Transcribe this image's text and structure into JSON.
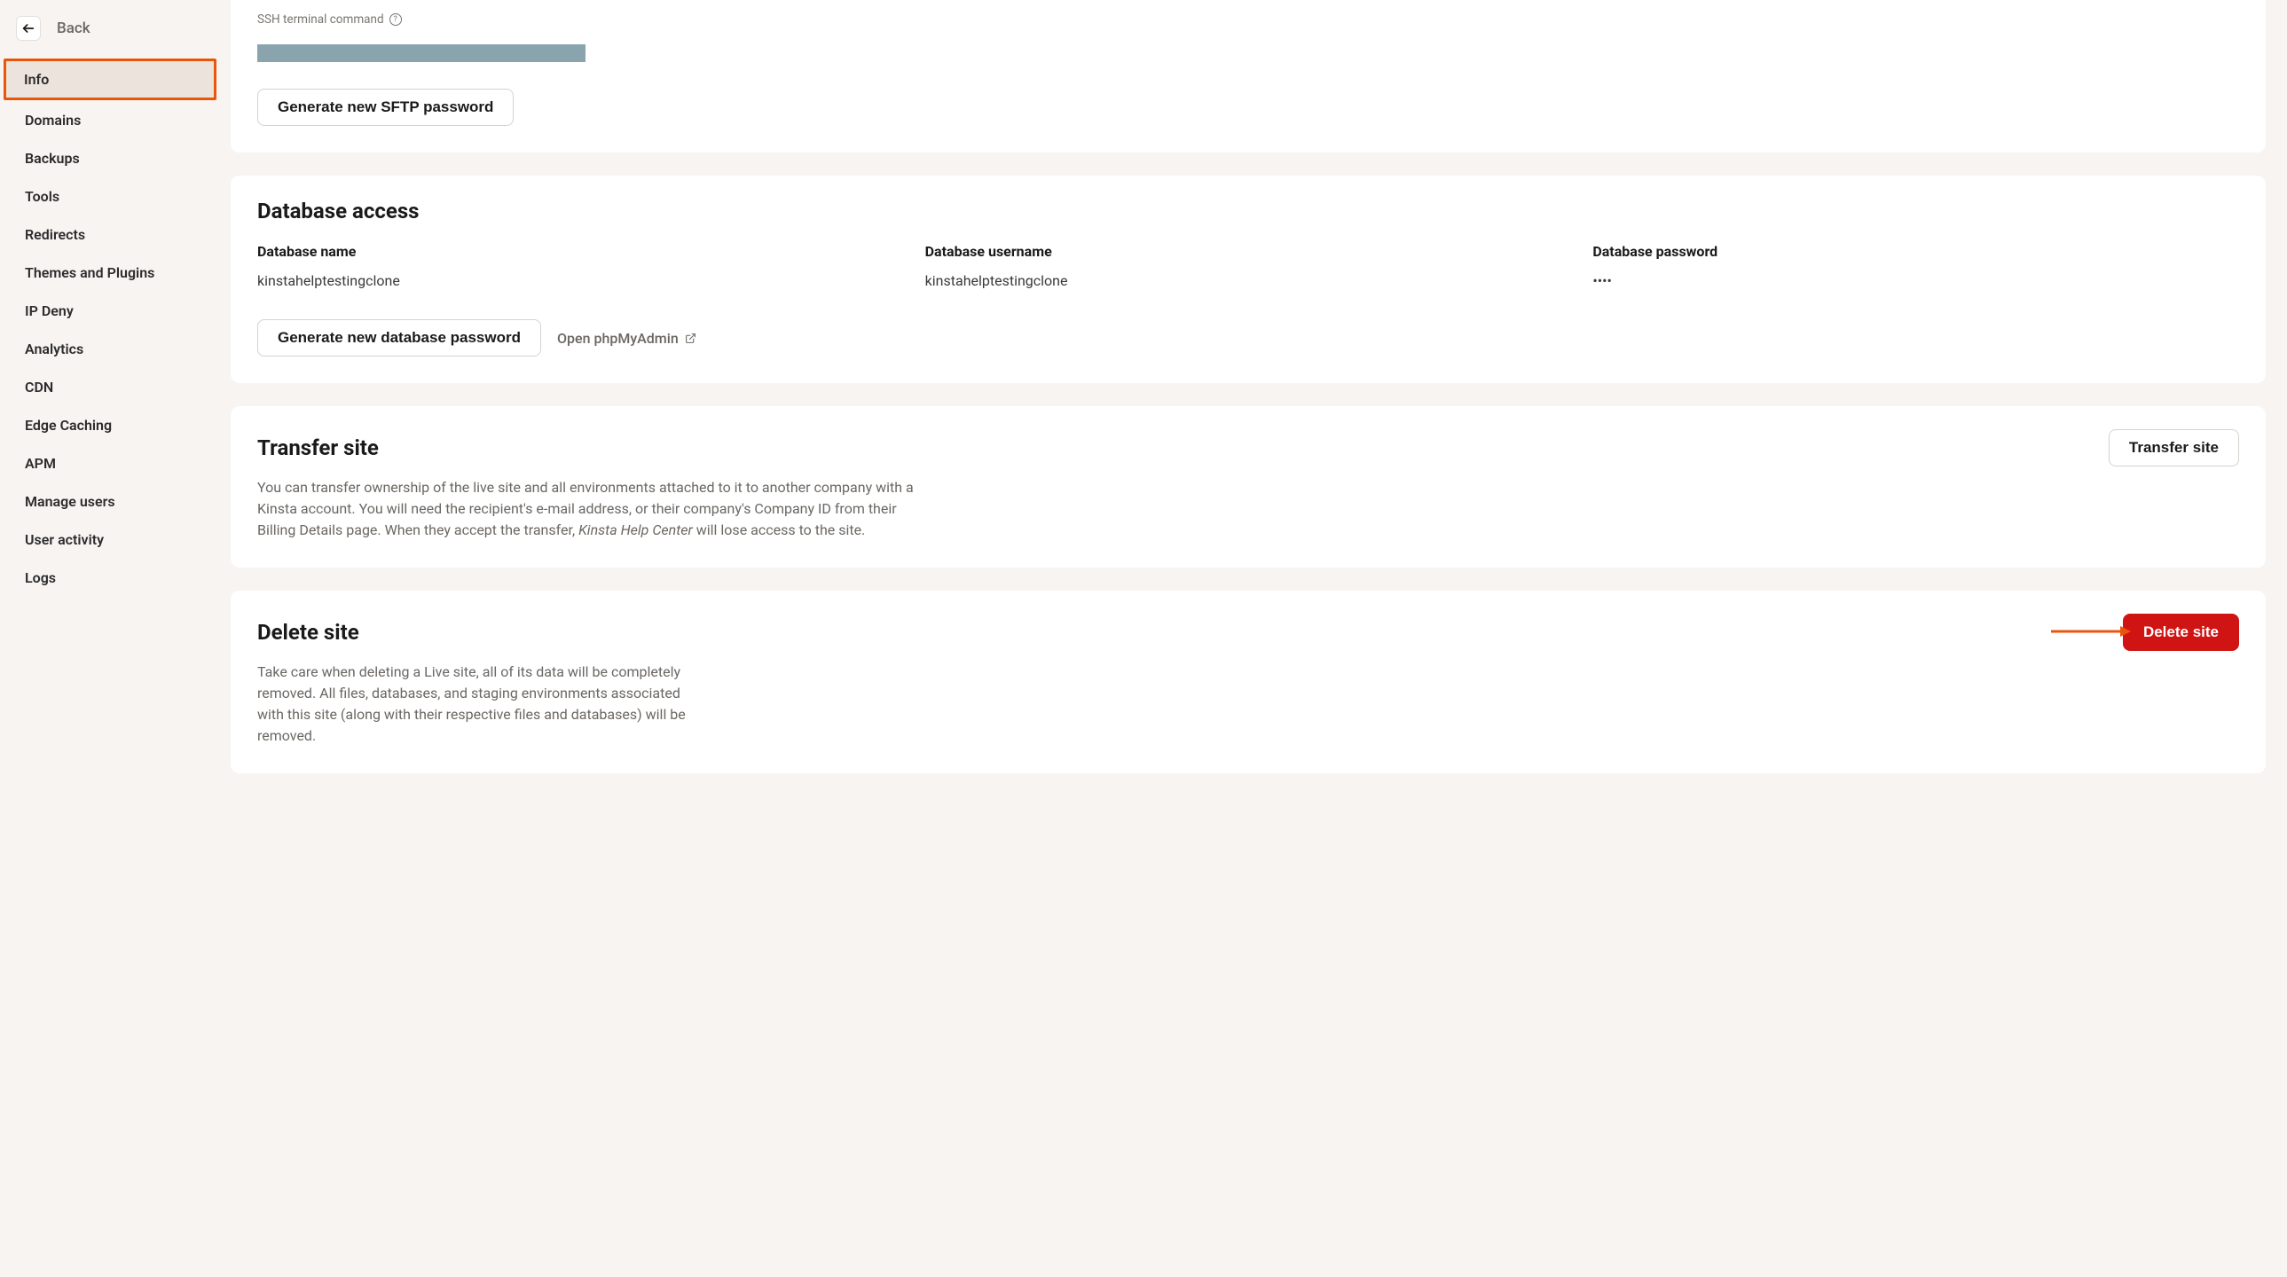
{
  "sidebar": {
    "back_label": "Back",
    "items": [
      {
        "label": "Info",
        "active": true
      },
      {
        "label": "Domains"
      },
      {
        "label": "Backups"
      },
      {
        "label": "Tools"
      },
      {
        "label": "Redirects"
      },
      {
        "label": "Themes and Plugins"
      },
      {
        "label": "IP Deny"
      },
      {
        "label": "Analytics"
      },
      {
        "label": "CDN"
      },
      {
        "label": "Edge Caching"
      },
      {
        "label": "APM"
      },
      {
        "label": "Manage users"
      },
      {
        "label": "User activity"
      },
      {
        "label": "Logs"
      }
    ]
  },
  "ssh": {
    "label": "SSH terminal command",
    "generate_btn": "Generate new SFTP password"
  },
  "db": {
    "heading": "Database access",
    "name_label": "Database name",
    "name_value": "kinstahelptestingclone",
    "user_label": "Database username",
    "user_value": "kinstahelptestingclone",
    "pw_label": "Database password",
    "pw_value": "••••",
    "generate_btn": "Generate new database password",
    "open_pma": "Open phpMyAdmin"
  },
  "transfer": {
    "heading": "Transfer site",
    "button": "Transfer site",
    "body_pre": "You can transfer ownership of the live site and all environments attached to it to another company with a Kinsta account. You will need the recipient's e-mail address, or their company's Company ID from their Billing Details page. When they accept the transfer, ",
    "body_italic": "Kinsta Help Center",
    "body_post": " will lose access to the site."
  },
  "delete": {
    "heading": "Delete site",
    "button": "Delete site",
    "body": "Take care when deleting a Live site, all of its data will be completely removed. All files, databases, and staging environments associated with this site (along with their respective files and databases) will be removed."
  }
}
